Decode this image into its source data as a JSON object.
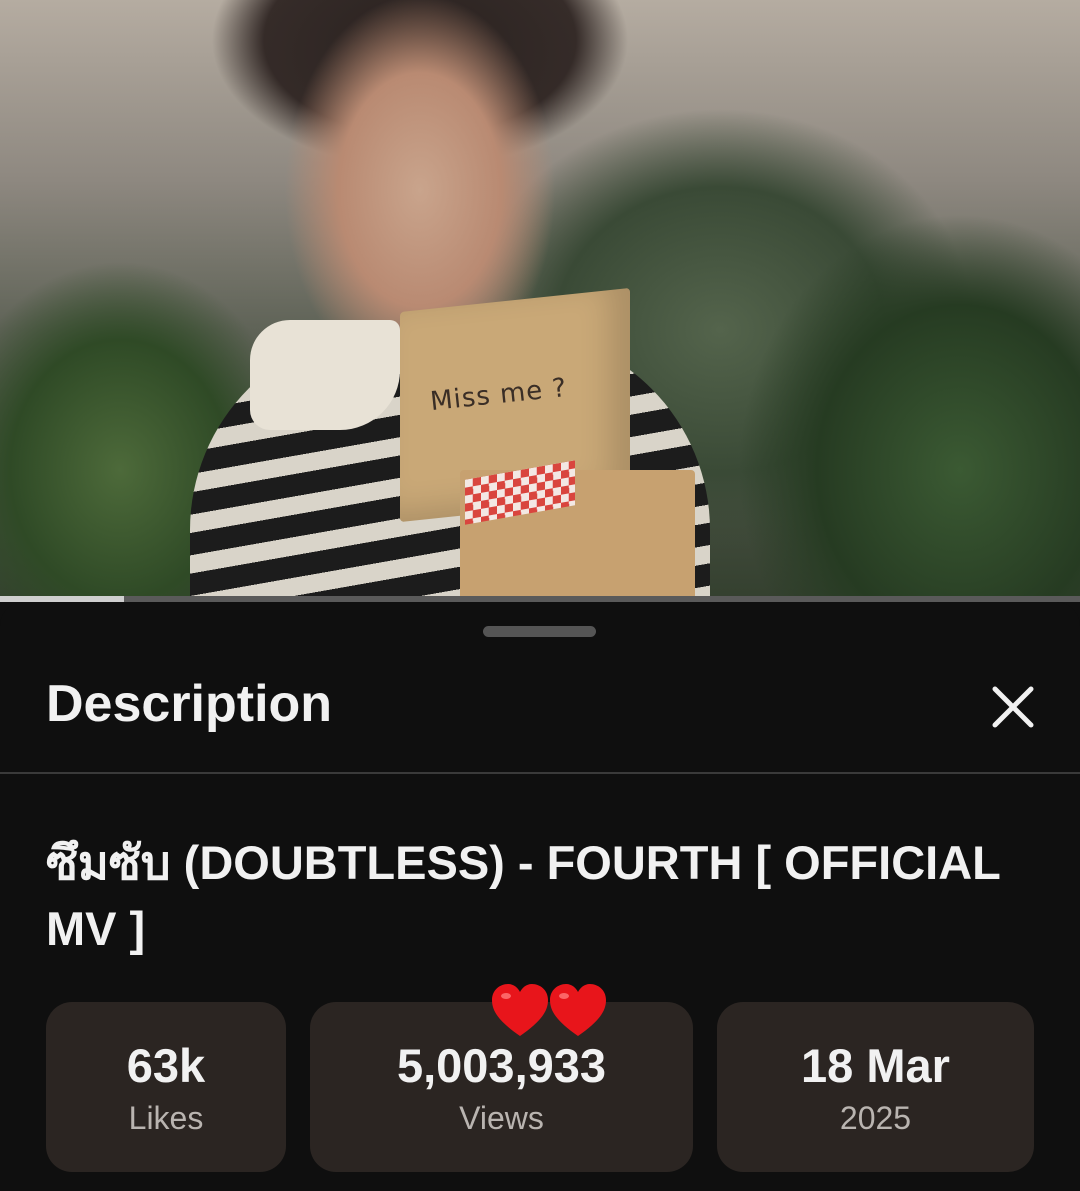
{
  "video": {
    "box_text": "Miss me ?",
    "progress_fraction": 0.115
  },
  "description_panel": {
    "title": "Description",
    "close_icon": "close-icon",
    "video_title": "ซึมซับ (DOUBTLESS) - FOURTH  [ OFFICIAL MV ]",
    "stats": {
      "likes": {
        "value": "63k",
        "label": "Likes"
      },
      "views": {
        "value": "5,003,933",
        "label": "Views"
      },
      "date": {
        "value": "18 Mar",
        "label": "2025"
      }
    },
    "sticker": "heart-emoji-pair"
  },
  "colors": {
    "sheet_bg": "#0f0f0f",
    "chip_bg": "#2b2522",
    "heart": "#e8151b"
  }
}
